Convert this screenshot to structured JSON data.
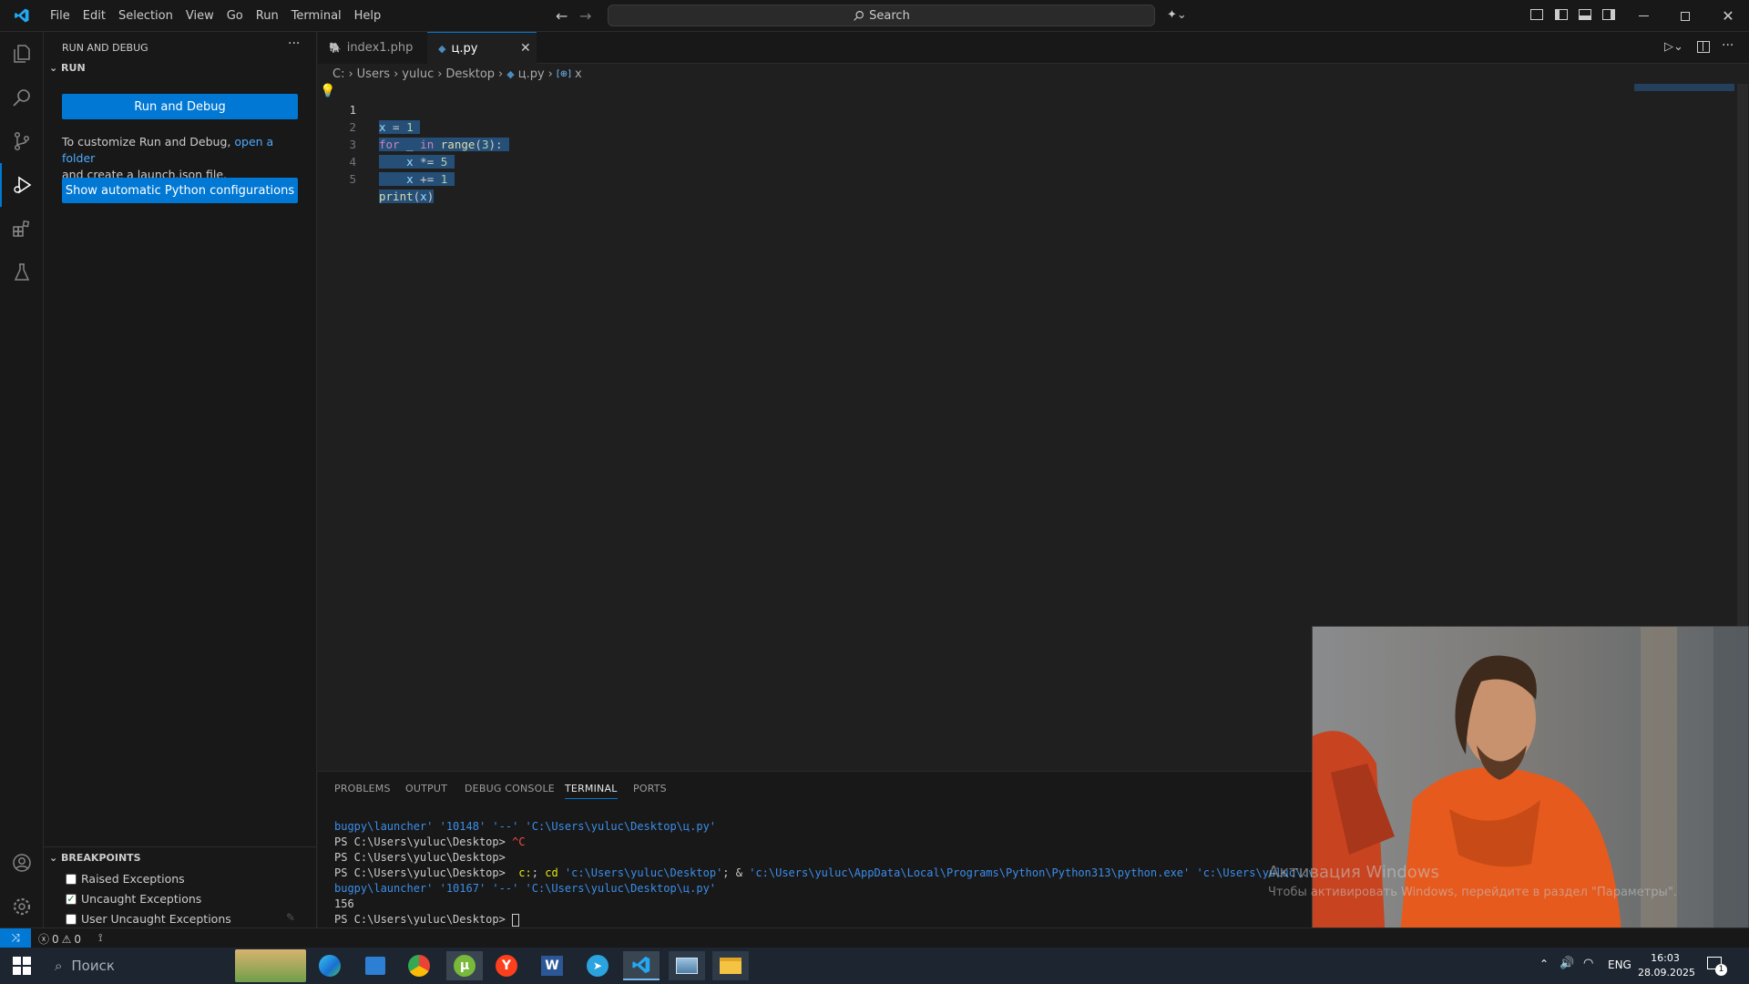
{
  "titlebar": {
    "menu": [
      "File",
      "Edit",
      "Selection",
      "View",
      "Go",
      "Run",
      "Terminal",
      "Help"
    ],
    "search_placeholder": "Search"
  },
  "sidebar": {
    "title": "RUN AND DEBUG",
    "section": "RUN",
    "run_button": "Run and Debug",
    "help_text_1": "To customize Run and Debug,",
    "help_link": "open a folder",
    "help_text_2": "and create a launch.json file.",
    "python_button": "Show automatic Python configurations",
    "breakpoints_title": "BREAKPOINTS",
    "breakpoints": [
      {
        "label": "Raised Exceptions",
        "checked": false
      },
      {
        "label": "Uncaught Exceptions",
        "checked": true
      },
      {
        "label": "User Uncaught Exceptions",
        "checked": false
      }
    ]
  },
  "tabs": [
    {
      "label": "index1.php",
      "active": false
    },
    {
      "label": "ц.py",
      "active": true
    }
  ],
  "breadcrumb": [
    "C:",
    "Users",
    "yuluc",
    "Desktop",
    "ц.py",
    "x"
  ],
  "editor": {
    "line_numbers": [
      "1",
      "2",
      "3",
      "4",
      "5"
    ]
  },
  "panel": {
    "tabs": [
      "PROBLEMS",
      "OUTPUT",
      "DEBUG CONSOLE",
      "TERMINAL",
      "PORTS"
    ],
    "active_tab": "TERMINAL",
    "terminal": {
      "l1a": "bugpy\\launcher' ",
      "l1b": "'10148' '--' 'C:\\Users\\yuluc\\Desktop\\ц.py'",
      "l2a": "PS C:\\Users\\yuluc\\Desktop> ",
      "l2b": "^C",
      "l3": "PS C:\\Users\\yuluc\\Desktop>",
      "l4a": "PS C:\\Users\\yuluc\\Desktop> ",
      "l4b": " c:",
      "l4c": "; ",
      "l4d": "cd",
      "l4e": " 'c:\\Users\\yuluc\\Desktop'",
      "l4f": "; & ",
      "l4g": "'c:\\Users\\yuluc\\AppData\\Local\\Programs\\Python\\Python313\\python.exe' 'c:\\Users\\yuluc\\.vsco",
      "l5a": "bugpy\\launcher' ",
      "l5b": "'10167' '--' 'C:\\Users\\yuluc\\Desktop\\ц.py'",
      "l6": "156",
      "l7": "PS C:\\Users\\yuluc\\Desktop> "
    }
  },
  "statusbar": {
    "errors": "0",
    "warnings": "0"
  },
  "watermark": {
    "title": "Активация Windows",
    "subtitle": "Чтобы активировать Windows, перейдите в раздел \"Параметры\"."
  },
  "taskbar": {
    "search_placeholder": "Поиск",
    "lang": "ENG",
    "time": "16:03",
    "date": "28.09.2025",
    "notif_count": "1"
  }
}
